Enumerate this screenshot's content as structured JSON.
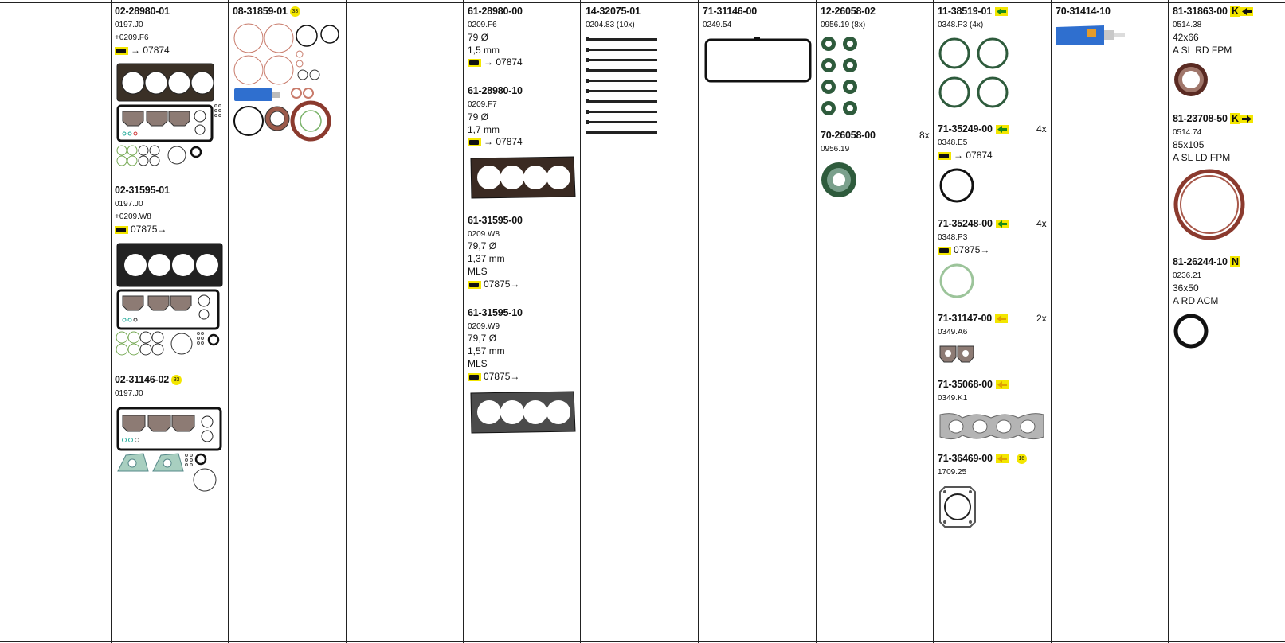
{
  "columns": {
    "c1": {
      "items": [
        {
          "pn": "02-28980-01",
          "code": "0197.J0",
          "extra": "+0209.F6",
          "engine": "07874"
        },
        {
          "pn": "02-31595-01",
          "code": "0197.J0",
          "extra": "+0209.W8",
          "engine": "07875→"
        },
        {
          "pn": "02-31146-02",
          "badge": "33",
          "code": "0197.J0"
        }
      ]
    },
    "c2": {
      "items": [
        {
          "pn": "08-31859-01",
          "badge": "33"
        }
      ]
    },
    "c4": {
      "items": [
        {
          "pn": "61-28980-00",
          "code": "0209.F6",
          "dia": "79 Ø",
          "thk": "1,5 mm",
          "engine": "07874"
        },
        {
          "pn": "61-28980-10",
          "code": "0209.F7",
          "dia": "79 Ø",
          "thk": "1,7 mm",
          "engine": "07874"
        },
        {
          "pn": "61-31595-00",
          "code": "0209.W8",
          "dia": "79,7 Ø",
          "thk": "1,37 mm",
          "mat": "MLS",
          "engine": "07875→"
        },
        {
          "pn": "61-31595-10",
          "code": "0209.W9",
          "dia": "79,7 Ø",
          "thk": "1,57 mm",
          "mat": "MLS",
          "engine": "07875→"
        }
      ]
    },
    "c5": {
      "items": [
        {
          "pn": "14-32075-01",
          "code": "0204.83 (10x)"
        }
      ]
    },
    "c6": {
      "items": [
        {
          "pn": "71-31146-00",
          "code": "0249.54"
        }
      ]
    },
    "c7": {
      "items": [
        {
          "pn": "12-26058-02",
          "code": "0956.19 (8x)"
        },
        {
          "pn": "70-26058-00",
          "code": "0956.19",
          "qty": "8x"
        }
      ]
    },
    "c8": {
      "items": [
        {
          "pn": "11-38519-01",
          "code": "0348.P3 (4x)"
        },
        {
          "pn": "71-35249-00",
          "code": "0348.E5",
          "qty": "4x",
          "engine": "07874"
        },
        {
          "pn": "71-35248-00",
          "code": "0348.P3",
          "qty": "4x",
          "engine": "07875→"
        },
        {
          "pn": "71-31147-00",
          "code": "0349.A6",
          "qty": "2x"
        },
        {
          "pn": "71-35068-00",
          "code": "0349.K1"
        },
        {
          "pn": "71-36469-00",
          "code": "1709.25",
          "badge": "16"
        }
      ]
    },
    "c9": {
      "items": [
        {
          "pn": "70-31414-10"
        }
      ]
    },
    "c10": {
      "items": [
        {
          "pn": "81-31863-00",
          "flag": "K",
          "code": "0514.38",
          "size": "42x66",
          "desc": "A SL RD FPM"
        },
        {
          "pn": "81-23708-50",
          "flag": "K",
          "code": "0514.74",
          "size": "85x105",
          "desc": "A SL LD FPM"
        },
        {
          "pn": "81-26244-10",
          "flag": "N",
          "code": "0236.21",
          "size": "36x50",
          "desc": "A RD ACM"
        }
      ]
    }
  },
  "colors": {
    "highlight": "#f3e600",
    "gasket_dark": "#222222",
    "seal_brown": "#8b3a2e",
    "seal_green": "#2e5b3c",
    "gasket_gray": "#9a9a9a"
  },
  "icons": [
    "engine-icon",
    "right-arrow-icon",
    "left-arrow-icon",
    "part-number-badge-icon"
  ]
}
